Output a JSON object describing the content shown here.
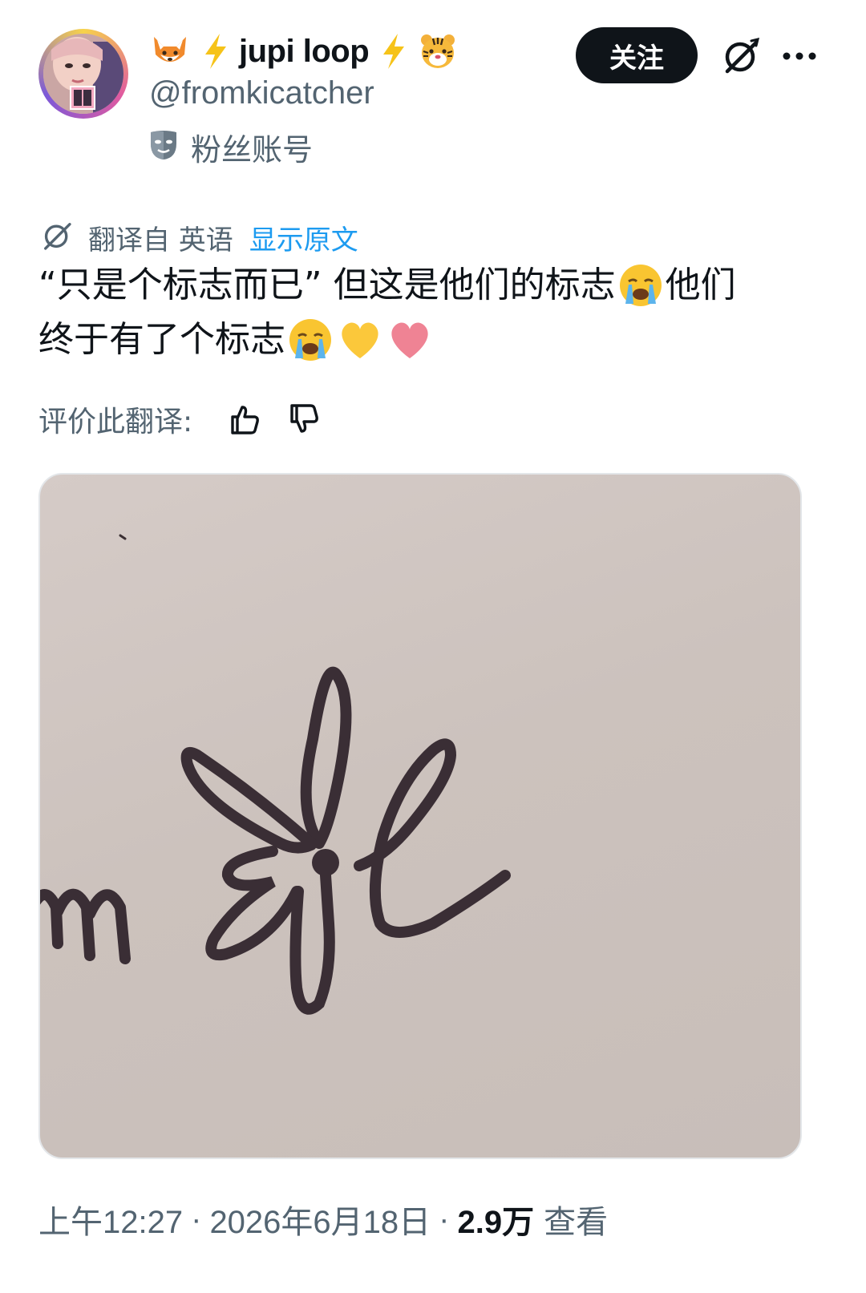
{
  "header": {
    "display_name": "jupi loop",
    "name_emojis": [
      "fox-emoji",
      "lightning-emoji",
      "lightning-emoji",
      "tiger-emoji"
    ],
    "handle": "@fromkicatcher",
    "fan_account_label": "粉丝账号",
    "follow_label": "关注"
  },
  "translation": {
    "translated_from": "翻译自 英语",
    "show_original": "显示原文"
  },
  "tweet": {
    "line1_text": "“只是个标志而已” 但这是他们的标志",
    "line1_tail": " 他们",
    "line2_text": "终于有了个标志",
    "emojis": [
      "crying-face-emoji",
      "crying-face-emoji",
      "yellow-heart-emoji",
      "pink-heart-emoji"
    ]
  },
  "rating": {
    "label": "评价此翻译:"
  },
  "media": {
    "description_icon": "signature-image"
  },
  "meta": {
    "time": "上午12:27",
    "separator": "·",
    "date": "2026年6月18日",
    "views_count": "2.9万",
    "views_label": "查看"
  },
  "colors": {
    "text": "#0f1419",
    "secondary": "#536471",
    "link": "#1d9bf0",
    "follow_bg": "#0f1419"
  }
}
